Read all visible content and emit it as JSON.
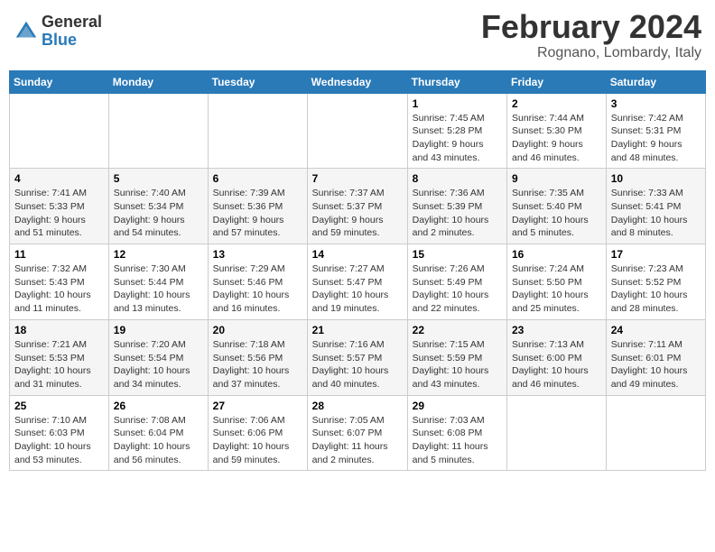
{
  "header": {
    "logo_general": "General",
    "logo_blue": "Blue",
    "month_year": "February 2024",
    "location": "Rognano, Lombardy, Italy"
  },
  "days_of_week": [
    "Sunday",
    "Monday",
    "Tuesday",
    "Wednesday",
    "Thursday",
    "Friday",
    "Saturday"
  ],
  "weeks": [
    [
      {
        "day": "",
        "info": ""
      },
      {
        "day": "",
        "info": ""
      },
      {
        "day": "",
        "info": ""
      },
      {
        "day": "",
        "info": ""
      },
      {
        "day": "1",
        "info": "Sunrise: 7:45 AM\nSunset: 5:28 PM\nDaylight: 9 hours\nand 43 minutes."
      },
      {
        "day": "2",
        "info": "Sunrise: 7:44 AM\nSunset: 5:30 PM\nDaylight: 9 hours\nand 46 minutes."
      },
      {
        "day": "3",
        "info": "Sunrise: 7:42 AM\nSunset: 5:31 PM\nDaylight: 9 hours\nand 48 minutes."
      }
    ],
    [
      {
        "day": "4",
        "info": "Sunrise: 7:41 AM\nSunset: 5:33 PM\nDaylight: 9 hours\nand 51 minutes."
      },
      {
        "day": "5",
        "info": "Sunrise: 7:40 AM\nSunset: 5:34 PM\nDaylight: 9 hours\nand 54 minutes."
      },
      {
        "day": "6",
        "info": "Sunrise: 7:39 AM\nSunset: 5:36 PM\nDaylight: 9 hours\nand 57 minutes."
      },
      {
        "day": "7",
        "info": "Sunrise: 7:37 AM\nSunset: 5:37 PM\nDaylight: 9 hours\nand 59 minutes."
      },
      {
        "day": "8",
        "info": "Sunrise: 7:36 AM\nSunset: 5:39 PM\nDaylight: 10 hours\nand 2 minutes."
      },
      {
        "day": "9",
        "info": "Sunrise: 7:35 AM\nSunset: 5:40 PM\nDaylight: 10 hours\nand 5 minutes."
      },
      {
        "day": "10",
        "info": "Sunrise: 7:33 AM\nSunset: 5:41 PM\nDaylight: 10 hours\nand 8 minutes."
      }
    ],
    [
      {
        "day": "11",
        "info": "Sunrise: 7:32 AM\nSunset: 5:43 PM\nDaylight: 10 hours\nand 11 minutes."
      },
      {
        "day": "12",
        "info": "Sunrise: 7:30 AM\nSunset: 5:44 PM\nDaylight: 10 hours\nand 13 minutes."
      },
      {
        "day": "13",
        "info": "Sunrise: 7:29 AM\nSunset: 5:46 PM\nDaylight: 10 hours\nand 16 minutes."
      },
      {
        "day": "14",
        "info": "Sunrise: 7:27 AM\nSunset: 5:47 PM\nDaylight: 10 hours\nand 19 minutes."
      },
      {
        "day": "15",
        "info": "Sunrise: 7:26 AM\nSunset: 5:49 PM\nDaylight: 10 hours\nand 22 minutes."
      },
      {
        "day": "16",
        "info": "Sunrise: 7:24 AM\nSunset: 5:50 PM\nDaylight: 10 hours\nand 25 minutes."
      },
      {
        "day": "17",
        "info": "Sunrise: 7:23 AM\nSunset: 5:52 PM\nDaylight: 10 hours\nand 28 minutes."
      }
    ],
    [
      {
        "day": "18",
        "info": "Sunrise: 7:21 AM\nSunset: 5:53 PM\nDaylight: 10 hours\nand 31 minutes."
      },
      {
        "day": "19",
        "info": "Sunrise: 7:20 AM\nSunset: 5:54 PM\nDaylight: 10 hours\nand 34 minutes."
      },
      {
        "day": "20",
        "info": "Sunrise: 7:18 AM\nSunset: 5:56 PM\nDaylight: 10 hours\nand 37 minutes."
      },
      {
        "day": "21",
        "info": "Sunrise: 7:16 AM\nSunset: 5:57 PM\nDaylight: 10 hours\nand 40 minutes."
      },
      {
        "day": "22",
        "info": "Sunrise: 7:15 AM\nSunset: 5:59 PM\nDaylight: 10 hours\nand 43 minutes."
      },
      {
        "day": "23",
        "info": "Sunrise: 7:13 AM\nSunset: 6:00 PM\nDaylight: 10 hours\nand 46 minutes."
      },
      {
        "day": "24",
        "info": "Sunrise: 7:11 AM\nSunset: 6:01 PM\nDaylight: 10 hours\nand 49 minutes."
      }
    ],
    [
      {
        "day": "25",
        "info": "Sunrise: 7:10 AM\nSunset: 6:03 PM\nDaylight: 10 hours\nand 53 minutes."
      },
      {
        "day": "26",
        "info": "Sunrise: 7:08 AM\nSunset: 6:04 PM\nDaylight: 10 hours\nand 56 minutes."
      },
      {
        "day": "27",
        "info": "Sunrise: 7:06 AM\nSunset: 6:06 PM\nDaylight: 10 hours\nand 59 minutes."
      },
      {
        "day": "28",
        "info": "Sunrise: 7:05 AM\nSunset: 6:07 PM\nDaylight: 11 hours\nand 2 minutes."
      },
      {
        "day": "29",
        "info": "Sunrise: 7:03 AM\nSunset: 6:08 PM\nDaylight: 11 hours\nand 5 minutes."
      },
      {
        "day": "",
        "info": ""
      },
      {
        "day": "",
        "info": ""
      }
    ]
  ]
}
